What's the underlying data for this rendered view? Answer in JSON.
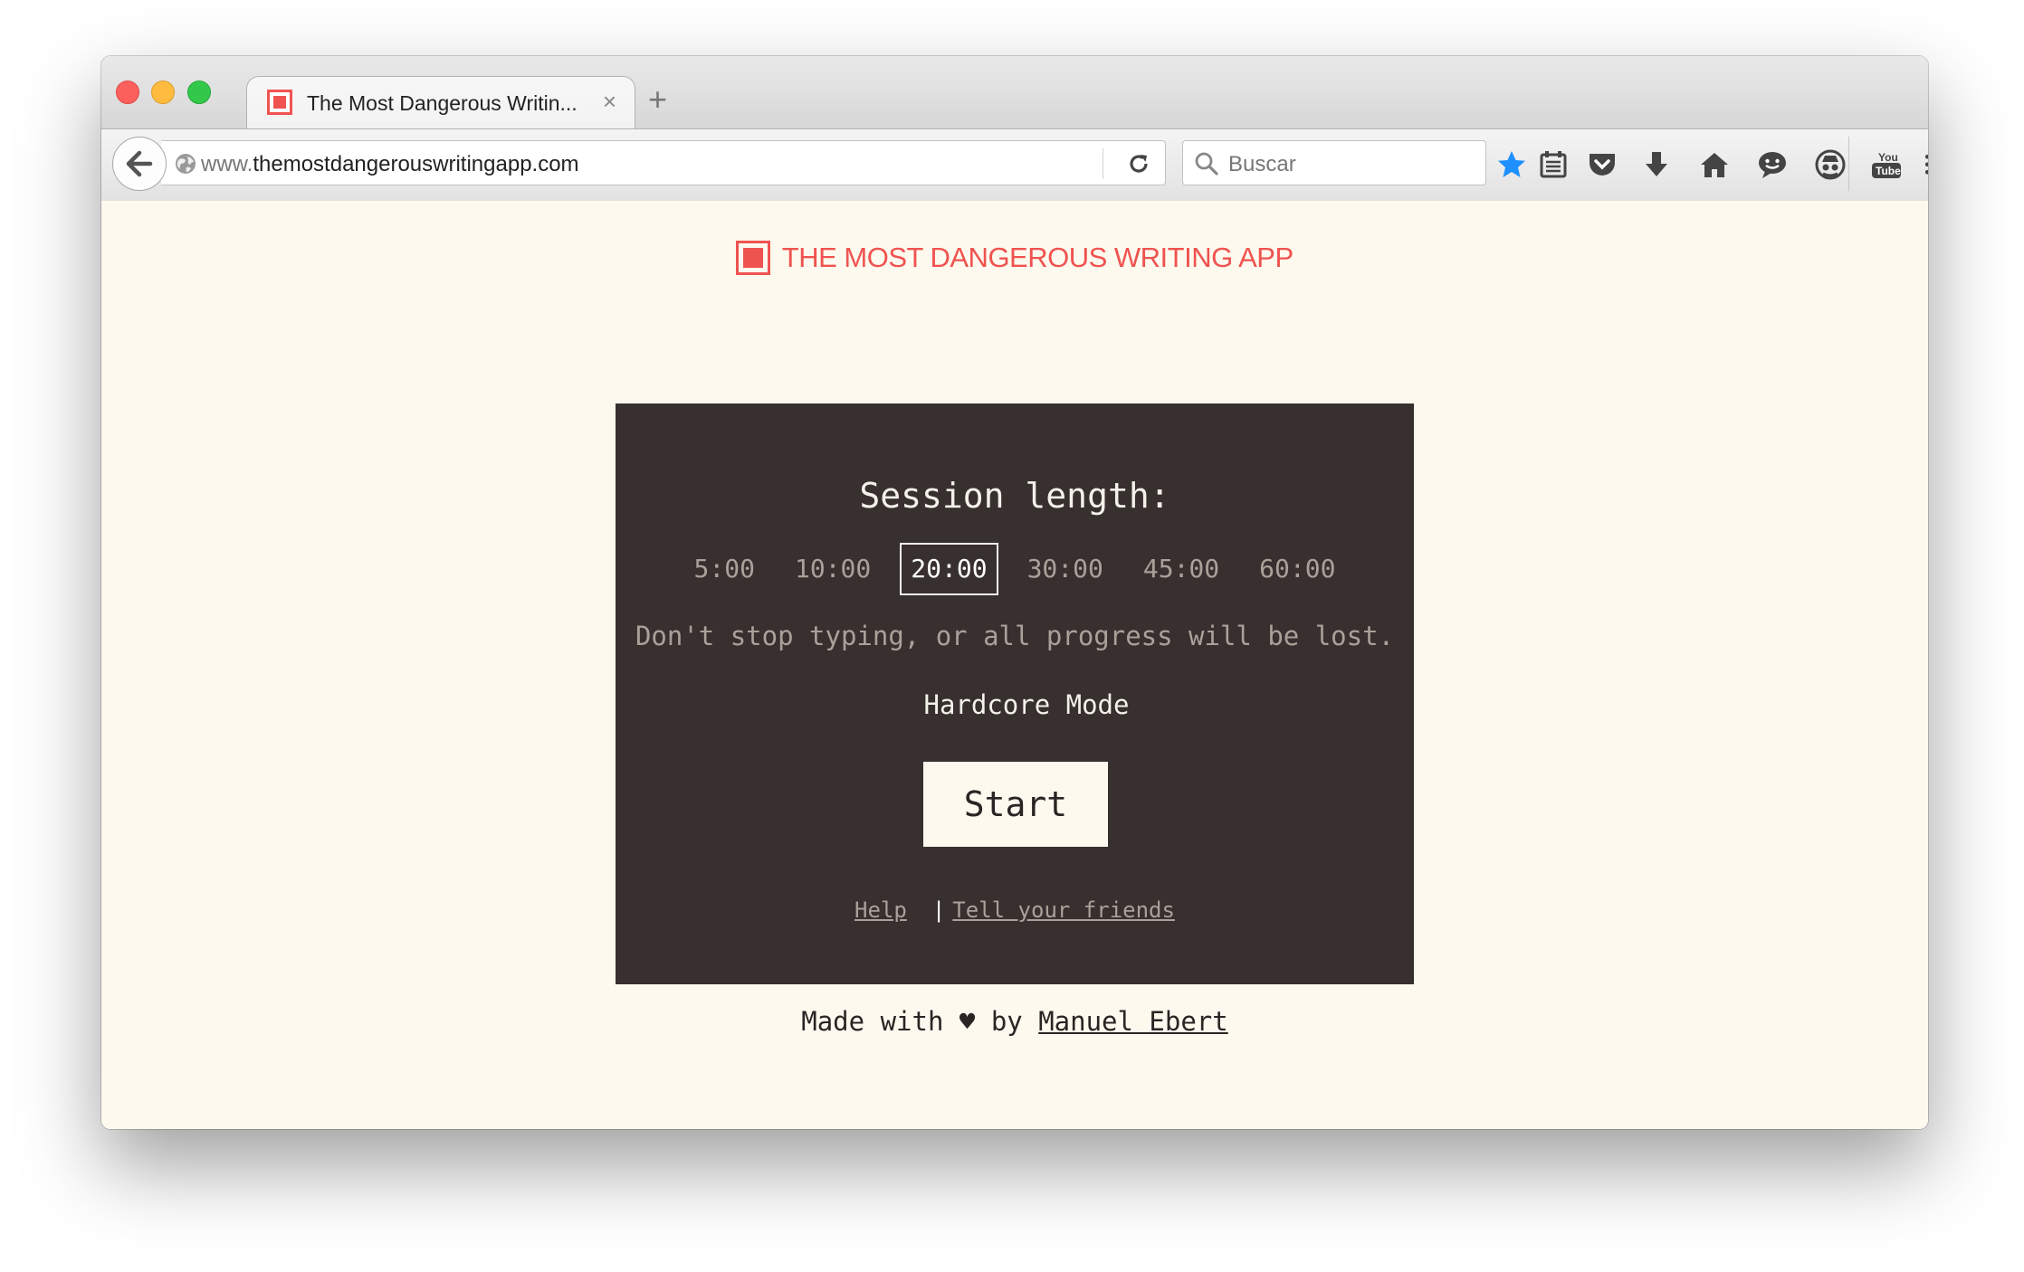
{
  "browser": {
    "tab_title": "The Most Dangerous Writin...",
    "tab_close": "×",
    "new_tab": "+",
    "url_prefix": "www.",
    "url_domain": "themostdangerouswritingapp.com",
    "search_placeholder": "Buscar",
    "toolbar_icons": [
      "bookmark-star-icon",
      "reading-list-icon",
      "pocket-icon",
      "download-icon",
      "home-icon",
      "chat-icon",
      "incognito-icon",
      "youtube-icon",
      "hamburger-menu-icon"
    ],
    "accent_color": "#1e90ff"
  },
  "app": {
    "logo_text": "THE MOST DANGEROUS WRITING APP",
    "brand_color": "#ef5350",
    "session_title": "Session length:",
    "durations": [
      "5:00",
      "10:00",
      "20:00",
      "30:00",
      "45:00",
      "60:00"
    ],
    "selected_duration": "20:00",
    "warning": "Don't stop typing, or all progress will be lost.",
    "hardcore_label": "Hardcore Mode",
    "start_label": "Start",
    "help_link": "Help",
    "separator": "|",
    "tell_friends_link": "Tell your friends",
    "made_with_prefix": "Made with",
    "heart": "♥",
    "made_with_by": "by",
    "author": "Manuel Ebert"
  }
}
